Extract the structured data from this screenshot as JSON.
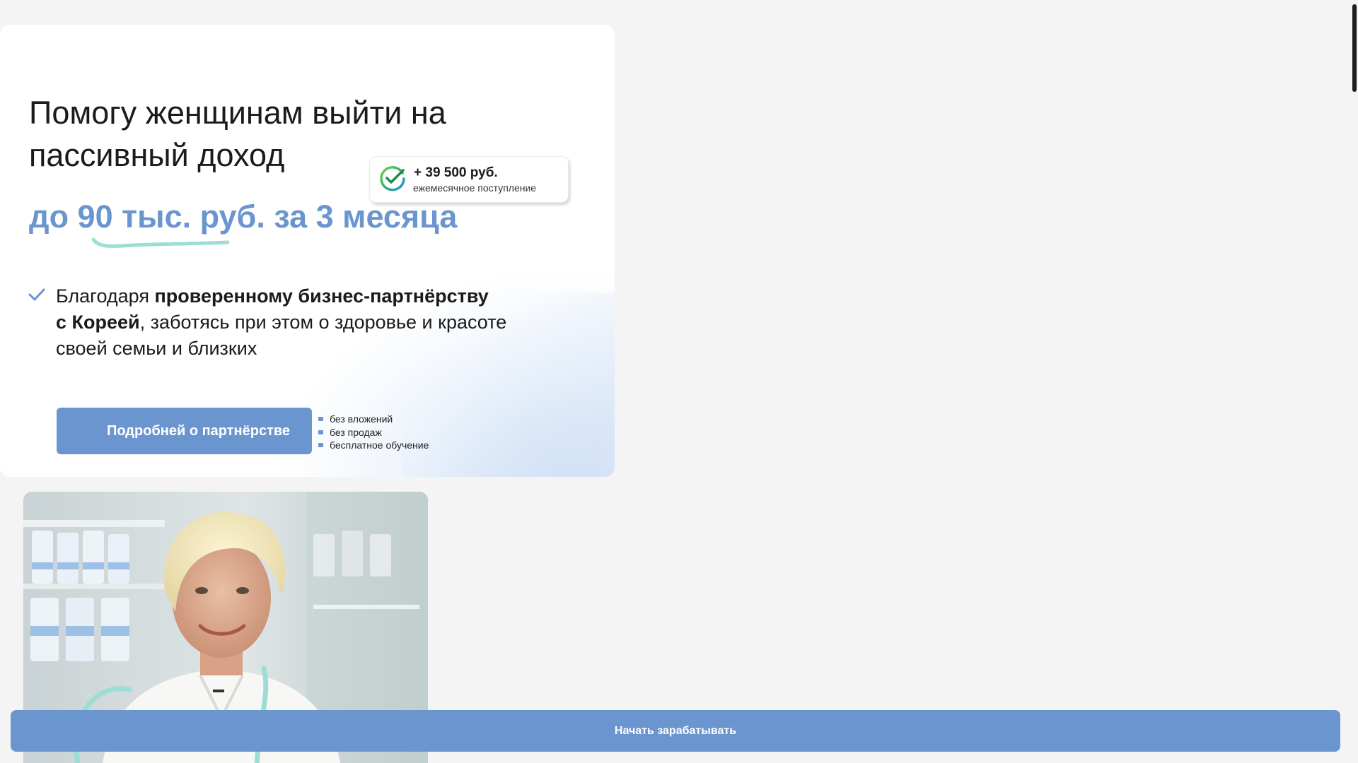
{
  "hero": {
    "headline": "Помогу женщинам выйти на пассивный доход",
    "headline_accent": "до 90 тыс. руб. за 3 месяца",
    "badge": {
      "amount": "+ 39 500 руб.",
      "caption": "ежемесячное поступление",
      "icon": "check-circle-icon"
    },
    "benefit": {
      "part1": "Благодаря ",
      "bold1": "проверенному бизнес-партнёрству",
      "bold2": "с Кореей",
      "part2": ", заботясь при этом о здоровье и красоте своей семьи и близких"
    },
    "cta_label": "Подробней о партнёрстве",
    "perks": [
      "без вложений",
      "без продаж",
      "бесплатное обучение"
    ]
  },
  "sticky_cta": {
    "label": "Начать зарабатывать"
  },
  "colors": {
    "accent": "#6b95cf",
    "swoosh": "#9dded4",
    "background": "#f4f4f4"
  }
}
